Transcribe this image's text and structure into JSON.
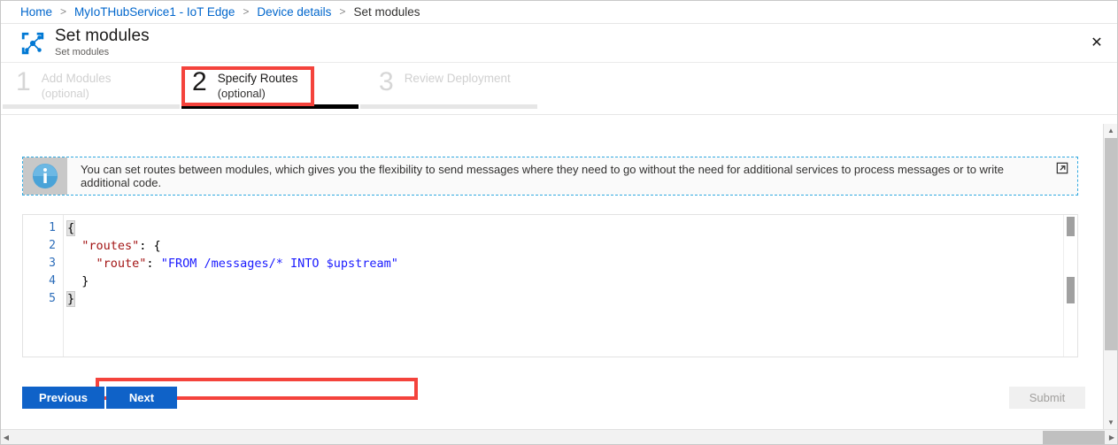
{
  "breadcrumb": {
    "items": [
      {
        "label": "Home",
        "current": false
      },
      {
        "label": "MyIoTHubService1 - IoT Edge",
        "current": false
      },
      {
        "label": "Device details",
        "current": false
      },
      {
        "label": "Set modules",
        "current": true
      }
    ],
    "separator": ">"
  },
  "header": {
    "title": "Set modules",
    "subtitle": "Set modules",
    "icon": "iot-edge-modules-icon",
    "close_label": "✕"
  },
  "steps": [
    {
      "number": "1",
      "label": "Add Modules",
      "optional": "(optional)",
      "active": false
    },
    {
      "number": "2",
      "label": "Specify Routes",
      "optional": "(optional)",
      "active": true
    },
    {
      "number": "3",
      "label": "Review Deployment",
      "optional": "",
      "active": false
    }
  ],
  "info_banner": {
    "icon": "info-circle-icon",
    "text": "You can set routes between modules, which gives you the flexibility to send messages where they need to go without the need for additional services to process messages or to write additional code.",
    "external_link_icon": "open-in-new-window-icon"
  },
  "editor": {
    "line_numbers": [
      "1",
      "2",
      "3",
      "4",
      "5"
    ],
    "lines": [
      {
        "indent": "",
        "segments": [
          {
            "text": "{",
            "type": "punc"
          }
        ]
      },
      {
        "indent": "  ",
        "segments": [
          {
            "text": "\"routes\"",
            "type": "key"
          },
          {
            "text": ": {",
            "type": "punc"
          }
        ]
      },
      {
        "indent": "    ",
        "segments": [
          {
            "text": "\"route\"",
            "type": "key"
          },
          {
            "text": ": ",
            "type": "punc"
          },
          {
            "text": "\"FROM /messages/* INTO $upstream\"",
            "type": "str"
          }
        ]
      },
      {
        "indent": "  ",
        "segments": [
          {
            "text": "}",
            "type": "punc"
          }
        ]
      },
      {
        "indent": "",
        "segments": [
          {
            "text": "}",
            "type": "punc"
          }
        ]
      }
    ],
    "code_text_line1": "{",
    "code_text_line2": "  \"routes\": {",
    "code_text_line3": "    \"route\": \"FROM /messages/* INTO $upstream\"",
    "code_text_line4": "  }",
    "code_text_line5": "}"
  },
  "footer": {
    "previous_label": "Previous",
    "next_label": "Next",
    "submit_label": "Submit",
    "submit_disabled": true
  },
  "annotations": {
    "accent_color": "#f4433c",
    "step_highlight": "Specify Routes step",
    "code_highlight": "route line"
  },
  "colors": {
    "link": "#0066cc",
    "primary_button": "#0f62c8",
    "active_bar": "#000000",
    "inactive_bar": "#e6e6e6",
    "info_border": "#31a9e0",
    "json_key": "#a31515",
    "json_string": "#1a1aff",
    "line_number": "#2b6cb9"
  }
}
